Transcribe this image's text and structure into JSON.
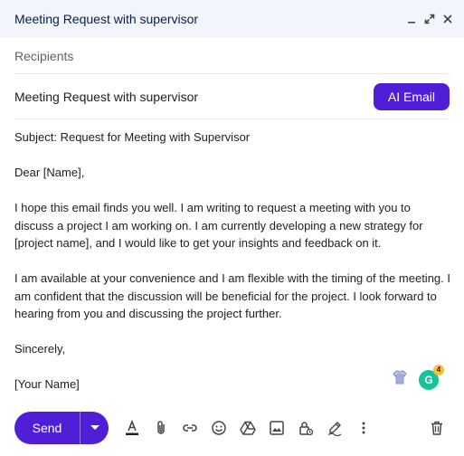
{
  "window": {
    "title": "Meeting Request with supervisor"
  },
  "recipients": {
    "placeholder": "Recipients"
  },
  "subject": {
    "value": "Meeting Request with supervisor",
    "ai_button": "AI Email"
  },
  "body": {
    "subject_line": "Subject: Request for Meeting with Supervisor",
    "greeting": "Dear [Name],",
    "paragraph1": "I hope this email finds you well. I am writing to request a meeting with you to discuss a project I am working on. I am currently developing a new strategy for [project name], and I would like to get your insights and feedback on it.",
    "paragraph2": "I am available at your convenience and I am flexible with the timing of the meeting. I am confident that the discussion will be beneficial for the project. I look forward to hearing from you and discussing the project further.",
    "closing": "Sincerely,",
    "signature": "[Your Name]"
  },
  "extensions": {
    "grammarly_count": "4"
  },
  "toolbar": {
    "send_label": "Send"
  },
  "colors": {
    "accent": "#4f1fd8",
    "title_bar": "#f2f6fc",
    "grammarly": "#15c39a"
  }
}
